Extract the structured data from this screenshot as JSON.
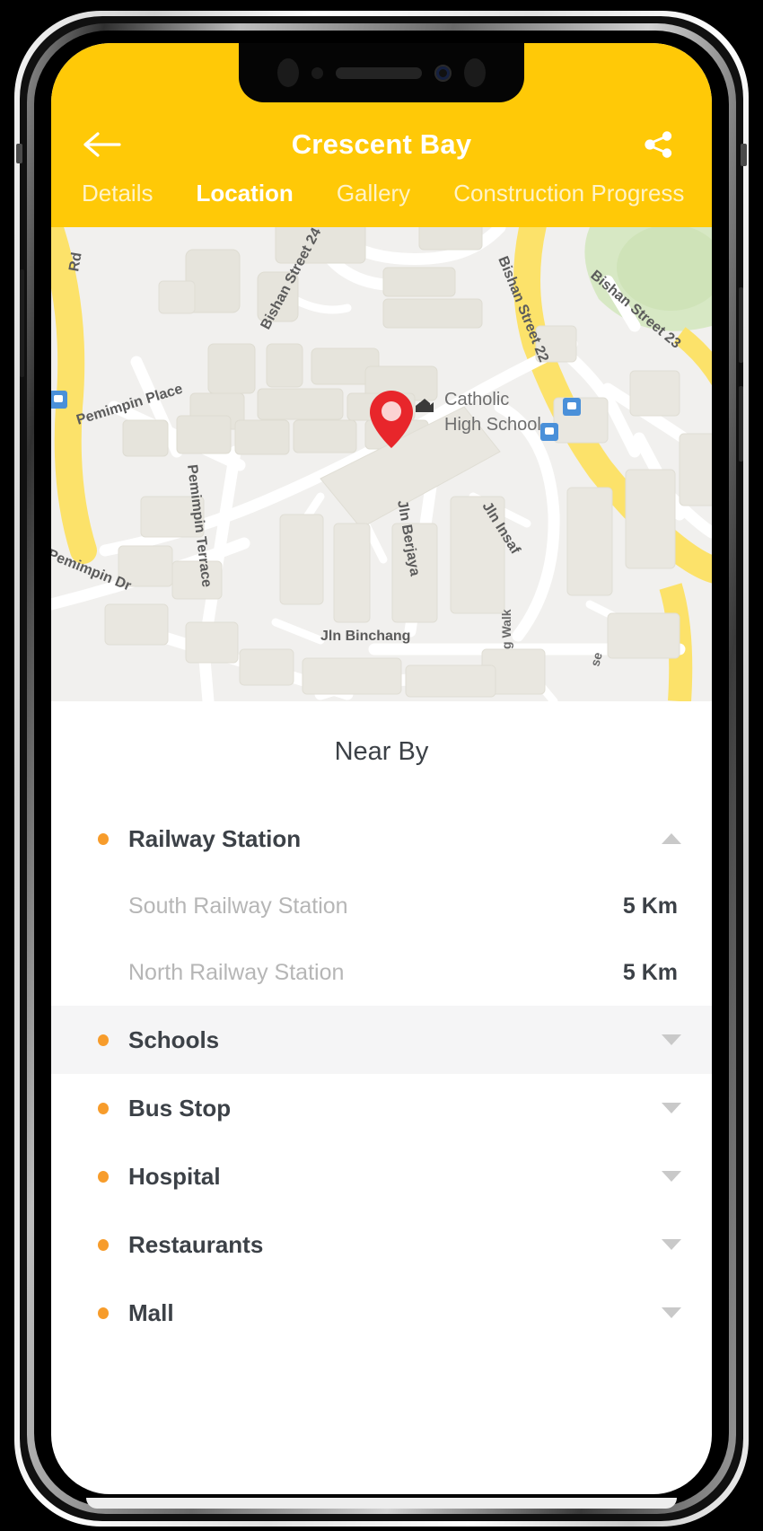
{
  "header": {
    "title": "Crescent Bay",
    "back_icon": "arrow-left-icon",
    "share_icon": "share-icon",
    "bg_color": "#FFC907"
  },
  "tabs": [
    {
      "label": "Details",
      "active": false
    },
    {
      "label": "Location",
      "active": true
    },
    {
      "label": "Gallery",
      "active": false
    },
    {
      "label": "Construction Progress",
      "active": false
    }
  ],
  "map": {
    "marker_icon": "map-pin-icon",
    "marker_color": "#E8262B",
    "poi_label": "Catholic\nHigh School",
    "poi_line1": "Catholic",
    "poi_line2": "High School",
    "poi_icon": "school-icon",
    "street_labels": [
      "Rd",
      "Bishan Street 24",
      "Bishan Street 22",
      "Bishan Street 23",
      "Pemimpin Place",
      "Pemimpin Terrace",
      "Pemimpin Dr",
      "Jln Berjaya",
      "Jln Insaf",
      "Jln Binchang",
      "g Walk"
    ],
    "transit_icon": "bus-stop-icon"
  },
  "nearby": {
    "title": "Near By",
    "categories": [
      {
        "label": "Railway Station",
        "expanded": true,
        "caret": "caret-up",
        "highlight": false,
        "items": [
          {
            "name": "South Railway Station",
            "distance": "5 Km"
          },
          {
            "name": "North Railway Station",
            "distance": "5 Km"
          }
        ]
      },
      {
        "label": "Schools",
        "expanded": false,
        "caret": "caret-down",
        "highlight": true,
        "items": []
      },
      {
        "label": "Bus Stop",
        "expanded": false,
        "caret": "caret-down",
        "highlight": false,
        "items": []
      },
      {
        "label": "Hospital",
        "expanded": false,
        "caret": "caret-down",
        "highlight": false,
        "items": []
      },
      {
        "label": "Restaurants",
        "expanded": false,
        "caret": "caret-down",
        "highlight": false,
        "items": []
      },
      {
        "label": "Mall",
        "expanded": false,
        "caret": "caret-down",
        "highlight": false,
        "items": []
      }
    ],
    "bullet_color": "#F79C2B"
  }
}
